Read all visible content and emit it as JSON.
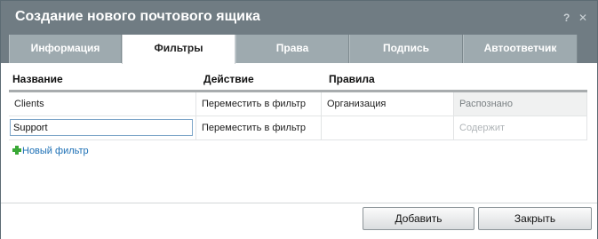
{
  "dialog": {
    "title": "Создание нового почтового ящика",
    "help_label": "?",
    "close_label": "✕"
  },
  "tabs": [
    {
      "label": "Информация",
      "active": false
    },
    {
      "label": "Фильтры",
      "active": true
    },
    {
      "label": "Права",
      "active": false
    },
    {
      "label": "Подпись",
      "active": false
    },
    {
      "label": "Автоответчик",
      "active": false
    }
  ],
  "table": {
    "headers": [
      "Название",
      "Действие",
      "Правила"
    ],
    "rows": [
      {
        "name": "Clients",
        "action": "Переместить в фильтр",
        "rule": "Организация",
        "condition": "Распознано"
      },
      {
        "name": "Support",
        "action": "Переместить в фильтр",
        "rule": "",
        "condition": "Содержит"
      }
    ]
  },
  "new_filter": {
    "label": "Новый фильтр",
    "icon": "plus-icon",
    "color": "#1b6fb5"
  },
  "buttons": {
    "add": "Добавить",
    "close": "Закрыть"
  },
  "colors": {
    "titlebar": "#707c83",
    "tab_inactive": "#9eaaaf",
    "accent_plus": "#39a836"
  }
}
